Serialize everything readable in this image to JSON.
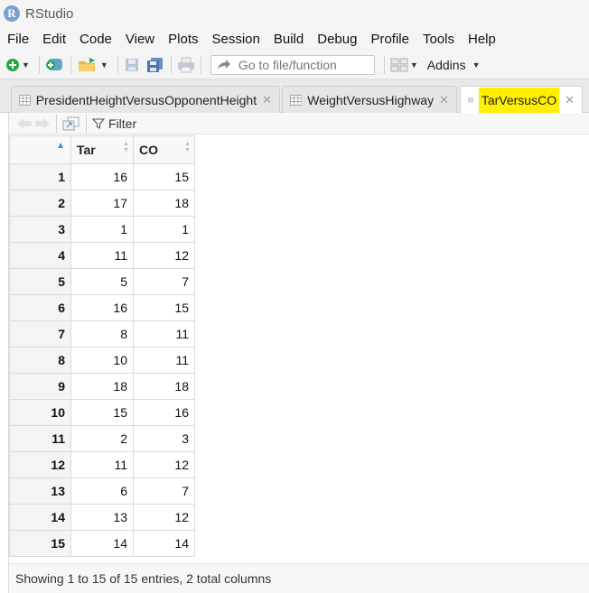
{
  "window": {
    "title": "RStudio",
    "logo_letter": "R"
  },
  "menu": [
    "File",
    "Edit",
    "Code",
    "View",
    "Plots",
    "Session",
    "Build",
    "Debug",
    "Profile",
    "Tools",
    "Help"
  ],
  "toolbar": {
    "goto_placeholder": "Go to file/function",
    "addins_label": "Addins"
  },
  "tabs": [
    {
      "label": "PresidentHeightVersusOpponentHeight",
      "active": false
    },
    {
      "label": "WeightVersusHighway",
      "active": false
    },
    {
      "label": "TarVersusCO",
      "active": true,
      "highlight_color": "#ffef00"
    }
  ],
  "viewer": {
    "filter_label": "Filter"
  },
  "table": {
    "columns": [
      "Tar",
      "CO"
    ],
    "rows": [
      {
        "n": "1",
        "tar": "16",
        "co": "15"
      },
      {
        "n": "2",
        "tar": "17",
        "co": "18"
      },
      {
        "n": "3",
        "tar": "1",
        "co": "1"
      },
      {
        "n": "4",
        "tar": "11",
        "co": "12"
      },
      {
        "n": "5",
        "tar": "5",
        "co": "7"
      },
      {
        "n": "6",
        "tar": "16",
        "co": "15"
      },
      {
        "n": "7",
        "tar": "8",
        "co": "11"
      },
      {
        "n": "8",
        "tar": "10",
        "co": "11"
      },
      {
        "n": "9",
        "tar": "18",
        "co": "18"
      },
      {
        "n": "10",
        "tar": "15",
        "co": "16"
      },
      {
        "n": "11",
        "tar": "2",
        "co": "3"
      },
      {
        "n": "12",
        "tar": "11",
        "co": "12"
      },
      {
        "n": "13",
        "tar": "6",
        "co": "7"
      },
      {
        "n": "14",
        "tar": "13",
        "co": "12"
      },
      {
        "n": "15",
        "tar": "14",
        "co": "14"
      }
    ]
  },
  "status": {
    "text": "Showing 1 to 15 of 15 entries, 2 total columns"
  },
  "colors": {
    "accent": "#2d8fe0",
    "highlight": "#ffef00"
  }
}
